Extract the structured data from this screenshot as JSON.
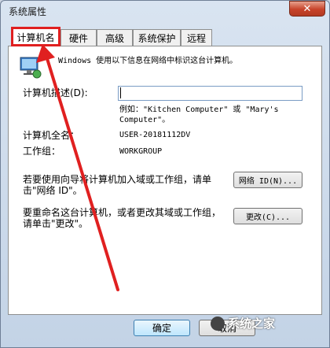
{
  "window": {
    "title": "系统属性",
    "close_glyph": "✕"
  },
  "tabs": [
    {
      "label": "计算机名",
      "active": true
    },
    {
      "label": "硬件"
    },
    {
      "label": "高级"
    },
    {
      "label": "系统保护"
    },
    {
      "label": "远程"
    }
  ],
  "content": {
    "intro": "Windows 使用以下信息在网络中标识这台计算机。",
    "desc_label": "计算机描述(D):",
    "desc_value": "",
    "example_line1": "例如：\"Kitchen Computer\" 或 \"Mary's",
    "example_line2": "Computer\"。",
    "full_name_label": "计算机全名：",
    "full_name_value": "USER-20181112DV",
    "workgroup_label": "工作组：",
    "workgroup_value": "WORKGROUP",
    "join_text_line1": "若要使用向导将计算机加入域或工作组，请单",
    "join_text_line2": "击\"网络 ID\"。",
    "network_id_button": "网络 ID(N)...",
    "rename_text_line1": "要重命名这台计算机，或者更改其域或工作组，",
    "rename_text_line2": "请单击\"更改\"。",
    "change_button": "更改(C)..."
  },
  "footer": {
    "ok_button": "确定",
    "cancel_button": "取消"
  },
  "watermark": {
    "text": "系统之家"
  },
  "colors": {
    "highlight": "#e02020",
    "window_frame": "#c3d3e6",
    "close_button": "#c7432a"
  },
  "icons": {
    "computer": "monitor-network-icon"
  }
}
